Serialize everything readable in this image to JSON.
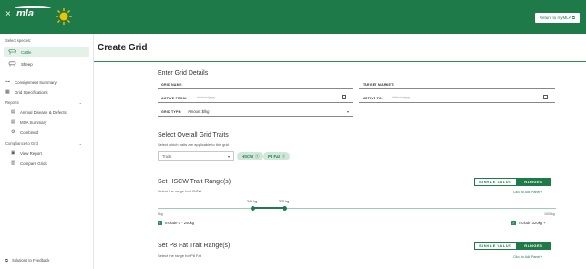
{
  "header": {
    "close_glyph": "×",
    "logo_text": "mla",
    "return_label": "Return to myMLA ⧉",
    "colors": {
      "brand": "#1f7a4a",
      "accent": "#2e8b57"
    }
  },
  "sidebar": {
    "select_species": "Select species:",
    "species": [
      {
        "label": "Cattle",
        "icon": "cattle-icon",
        "active": true
      },
      {
        "label": "Sheep",
        "icon": "sheep-icon",
        "active": false
      }
    ],
    "consignment_summary": "Consignment Summary",
    "grid_specifications": "Grid Specifications",
    "reports": "Reports",
    "report_items": [
      "Animal Disease & Defects",
      "MSA Summary",
      "Combined"
    ],
    "compliance": "Compliance to Grid",
    "compliance_items": [
      "View Report",
      "Compare Grids"
    ],
    "feedback": "Solutions to Feedback"
  },
  "page": {
    "title": "Create Grid"
  },
  "details": {
    "title": "Enter Grid Details",
    "grid_name_label": "GRID NAME:",
    "target_market_label": "TARGET MARKET:",
    "active_from_label": "ACTIVE FROM:",
    "active_from_placeholder": "dd/mm/yyyy",
    "active_to_label": "ACTIVE TO:",
    "active_to_placeholder": "dd/mm/yyyy",
    "grid_type_label": "GRID TYPE:",
    "grid_type_value": "Amount $/kg"
  },
  "traits": {
    "title": "Select Overall Grid Traits",
    "subtitle": "Select which traits are applicable to this grid",
    "dropdown_placeholder": "Traits",
    "chips": [
      "HSCW",
      "P8 Fat"
    ]
  },
  "hscw": {
    "title": "Set HSCW Trait Range(s)",
    "subtitle": "Select the range for HSCW",
    "single_value": "SINGLE VALUE",
    "ranges": "RANGES",
    "add_panel": "Click to Add Panel  +",
    "min": "0kg",
    "max": "1000kg",
    "low_value": "240 kg",
    "high_value": "320 kg",
    "low_fraction": 0.24,
    "high_fraction": 0.32,
    "include_low": "Include 0 - 240kg",
    "include_high": "Include 320kg +"
  },
  "p8": {
    "title": "Set P8 Fat Trait Range(s)",
    "subtitle": "Select the range for P8 Fat",
    "single_value": "SINGLE VALUE",
    "ranges": "RANGES",
    "add_panel": "Click to Add Panel  +"
  }
}
